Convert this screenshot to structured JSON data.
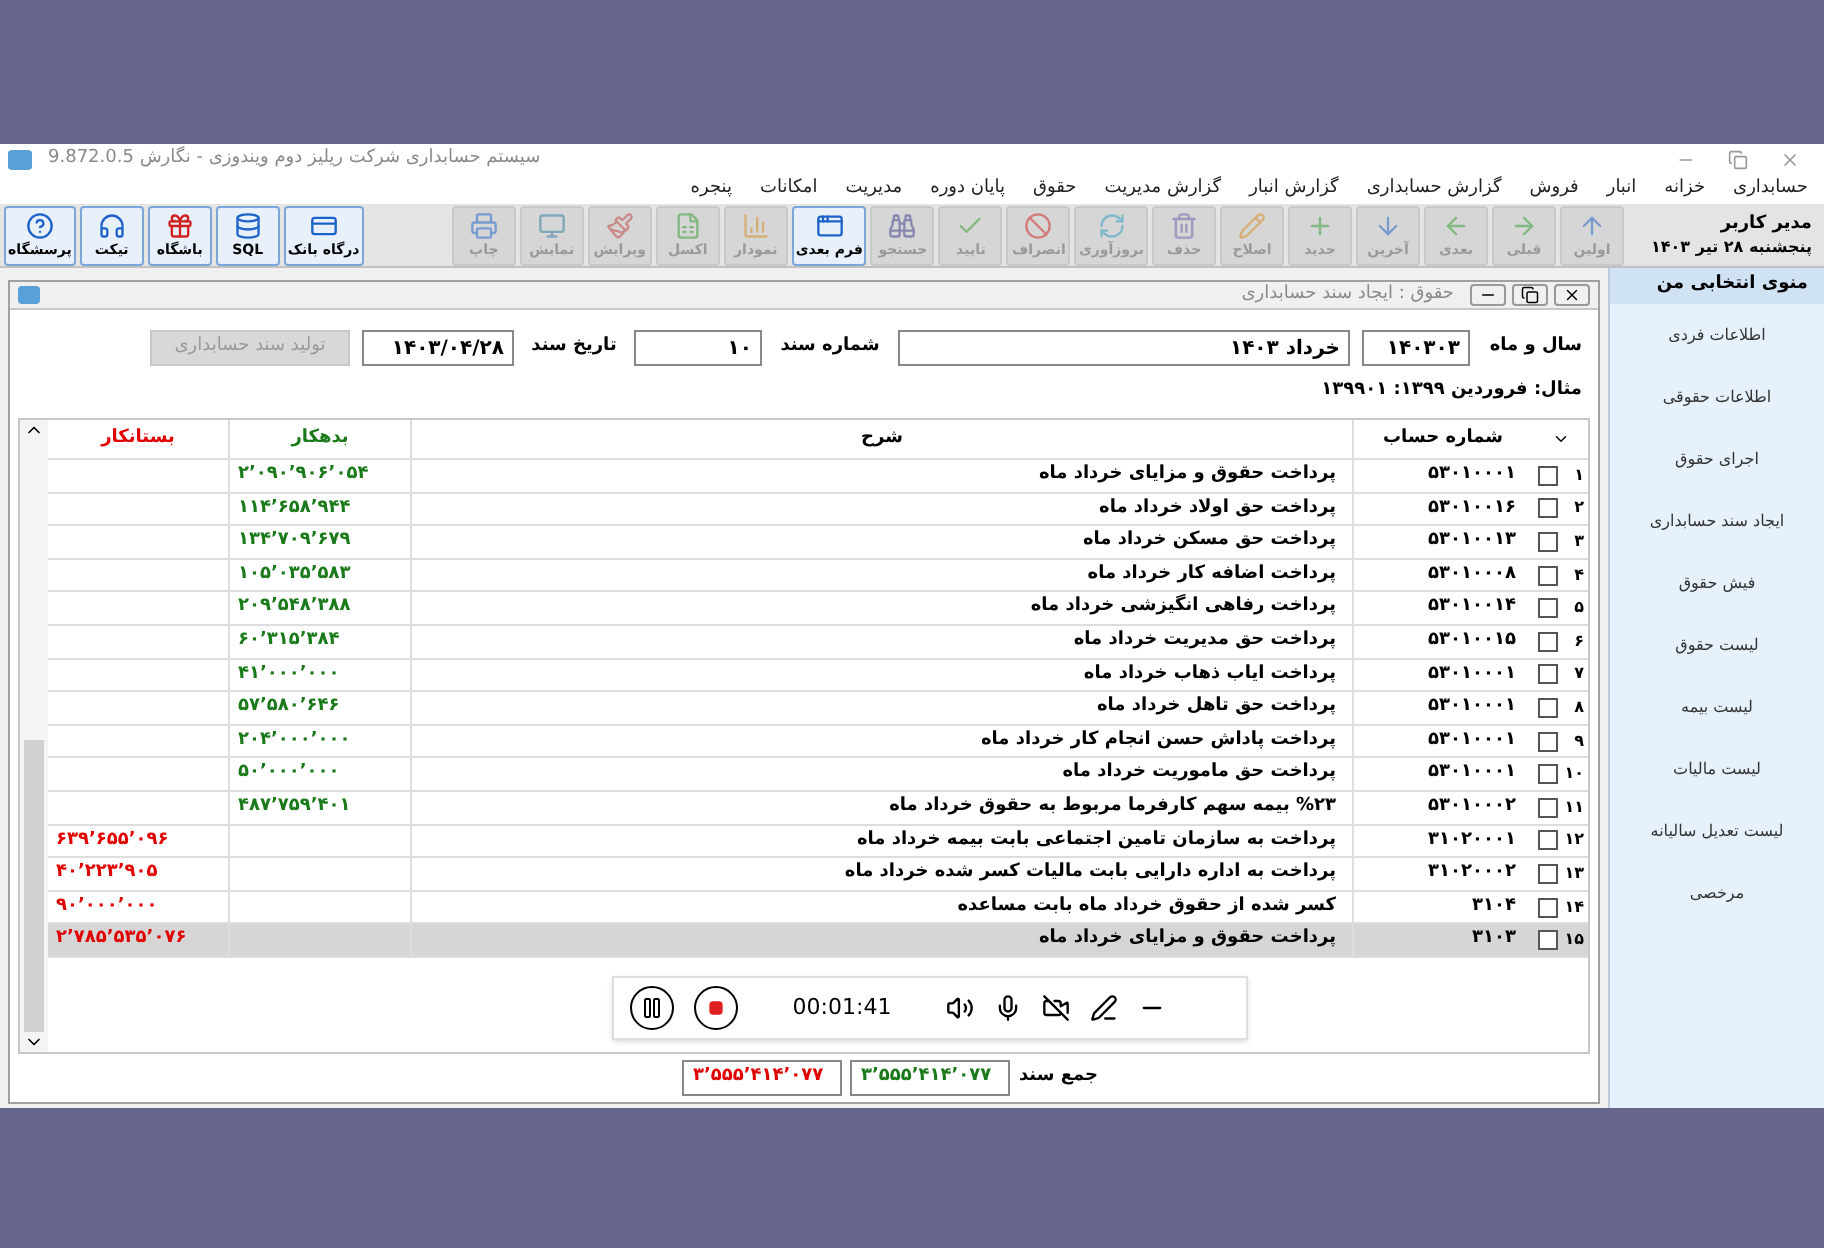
{
  "app": {
    "title": "سیستم حسابداری شرکت ریلیز دوم ویندوزی - نگارش 9.872.0.5"
  },
  "menu": [
    "حسابداری",
    "خزانه",
    "انبار",
    "فروش",
    "گزارش حسابداری",
    "گزارش انبار",
    "گزارش مدیریت",
    "حقوق",
    "پایان دوره",
    "مدیریت",
    "امکانات",
    "پنجره"
  ],
  "user": {
    "name": "مدیر کاربر",
    "date": "پنجشنبه ۲۸ تیر ۱۴۰۳"
  },
  "toolbar": [
    {
      "label": "اولین",
      "disabled": true
    },
    {
      "label": "قبلی",
      "disabled": true
    },
    {
      "label": "بعدی",
      "disabled": true
    },
    {
      "label": "آخرین",
      "disabled": true
    },
    {
      "label": "جدید",
      "disabled": true
    },
    {
      "label": "اصلاح",
      "disabled": true
    },
    {
      "label": "حذف",
      "disabled": true
    },
    {
      "label": "بروزآوری",
      "disabled": true
    },
    {
      "label": "انصراف",
      "disabled": true
    },
    {
      "label": "تایید",
      "disabled": true
    },
    {
      "label": "جستجو",
      "disabled": true
    },
    {
      "label": "فرم بعدی",
      "disabled": false
    },
    {
      "label": "نمودار",
      "disabled": true
    },
    {
      "label": "اکسل",
      "disabled": true
    },
    {
      "label": "ویرایش",
      "disabled": true
    },
    {
      "label": "نمایش",
      "disabled": true
    },
    {
      "label": "چاپ",
      "disabled": true
    }
  ],
  "tools": [
    {
      "label": "درگاه بانک",
      "disabled": false
    },
    {
      "label": "SQL",
      "disabled": false
    },
    {
      "label": "باشگاه",
      "disabled": false
    },
    {
      "label": "تیکت",
      "disabled": false
    },
    {
      "label": "پرسشگاه",
      "disabled": false
    }
  ],
  "document_window": {
    "title": "حقوق : ایجاد سند حسابداری",
    "year_month": {
      "label": "سال و ماه",
      "code": "۱۴۰۳۰۳",
      "name": "خرداد ۱۴۰۳"
    },
    "doc_number": {
      "label": "شماره سند",
      "value": "۱۰"
    },
    "doc_date": {
      "label": "تاریخ سند",
      "value": "۱۴۰۳/۰۴/۲۸"
    },
    "generate_button": {
      "label": "تولید سند حسابداری",
      "disabled": true
    },
    "hint": "مثال: فروردین ۱۳۹۹: ۱۳۹۹۰۱"
  },
  "table": {
    "columns": [
      "شماره حساب",
      "شرح",
      "بدهکار",
      "بستانکار"
    ],
    "rows": [
      {
        "number": "۱",
        "checked": false,
        "selected": false,
        "account": "۵۳۰۱۰۰۰۱",
        "description": "پرداخت حقوق و مزایای خرداد ماه",
        "debit": "۲٬۰۹۰٬۹۰۶٬۰۵۴"
      },
      {
        "number": "۲",
        "checked": false,
        "selected": false,
        "account": "۵۳۰۱۰۰۱۶",
        "description": "پرداخت حق اولاد خرداد ماه",
        "debit": "۱۱۴٬۶۵۸٬۹۴۴"
      },
      {
        "number": "۳",
        "checked": false,
        "selected": false,
        "account": "۵۳۰۱۰۰۱۳",
        "description": "پرداخت حق مسکن خرداد ماه",
        "debit": "۱۳۴٬۷۰۹٬۶۷۹"
      },
      {
        "number": "۴",
        "checked": false,
        "selected": false,
        "account": "۵۳۰۱۰۰۰۸",
        "description": "پرداخت اضافه کار خرداد ماه",
        "debit": "۱۰۵٬۰۳۵٬۵۸۳"
      },
      {
        "number": "۵",
        "checked": false,
        "selected": false,
        "account": "۵۳۰۱۰۰۱۴",
        "description": "پرداخت رفاهی انگیزشی خرداد ماه",
        "debit": "۲۰۹٬۵۴۸٬۳۸۸"
      },
      {
        "number": "۶",
        "checked": false,
        "selected": false,
        "account": "۵۳۰۱۰۰۱۵",
        "description": "پرداخت حق مدیریت خرداد ماه",
        "debit": "۶۰٬۳۱۵٬۳۸۴"
      },
      {
        "number": "۷",
        "checked": false,
        "selected": false,
        "account": "۵۳۰۱۰۰۰۱",
        "description": "پرداخت ایاب ذهاب خرداد ماه",
        "debit": "۴۱٬۰۰۰٬۰۰۰"
      },
      {
        "number": "۸",
        "checked": false,
        "selected": false,
        "account": "۵۳۰۱۰۰۰۱",
        "description": "پرداخت حق تاهل خرداد ماه",
        "debit": "۵۷٬۵۸۰٬۶۴۶"
      },
      {
        "number": "۹",
        "checked": false,
        "selected": false,
        "account": "۵۳۰۱۰۰۰۱",
        "description": "پرداخت پاداش حسن انجام کار خرداد ماه",
        "debit": "۲۰۴٬۰۰۰٬۰۰۰"
      },
      {
        "number": "۱۰",
        "checked": false,
        "selected": false,
        "account": "۵۳۰۱۰۰۰۱",
        "description": "پرداخت حق ماموریت خرداد ماه",
        "debit": "۵۰٬۰۰۰٬۰۰۰"
      },
      {
        "number": "۱۱",
        "checked": false,
        "selected": false,
        "account": "۵۳۰۱۰۰۰۲",
        "description": "%۲۳ بیمه سهم کارفرما مربوط به حقوق خرداد ماه",
        "debit": "۴۸۷٬۷۵۹٬۴۰۱"
      },
      {
        "number": "۱۲",
        "checked": false,
        "selected": false,
        "account": "۳۱۰۲۰۰۰۱",
        "description": "پرداخت به سازمان تامین اجتماعی بابت بیمه خرداد ماه",
        "credit": "۶۳۹٬۶۵۵٬۰۹۶"
      },
      {
        "number": "۱۳",
        "checked": false,
        "selected": false,
        "account": "۳۱۰۲۰۰۰۲",
        "description": "پرداخت به اداره دارایی بابت مالیات کسر شده خرداد ماه",
        "credit": "۴۰٬۲۲۳٬۹۰۵"
      },
      {
        "number": "۱۴",
        "checked": false,
        "selected": false,
        "account": "۳۱۰۴",
        "description": "کسر شده از حقوق خرداد ماه بابت مساعده",
        "credit": "۹۰٬۰۰۰٬۰۰۰"
      },
      {
        "number": "۱۵",
        "checked": false,
        "selected": true,
        "account": "۳۱۰۳",
        "description": "پرداخت حقوق و مزایای خرداد ماه",
        "credit": "۲٬۷۸۵٬۵۳۵٬۰۷۶"
      }
    ]
  },
  "total": {
    "label": "جمع سند",
    "debit": "۳٬۵۵۵٬۴۱۴٬۰۷۷",
    "credit": "۳٬۵۵۵٬۴۱۴٬۰۷۷"
  },
  "sidebar": {
    "title": "منوی انتخابی من",
    "items": [
      "اطلاعات فردی",
      "اطلاعات حقوقی",
      "اجرای حقوق",
      "ایجاد سند حسابداری",
      "فیش حقوق",
      "لیست حقوق",
      "لیست بیمه",
      "لیست مالیات",
      "لیست تعدیل سالیانه",
      "مرخصی"
    ]
  },
  "recorder": {
    "time": "00:01:41"
  }
}
